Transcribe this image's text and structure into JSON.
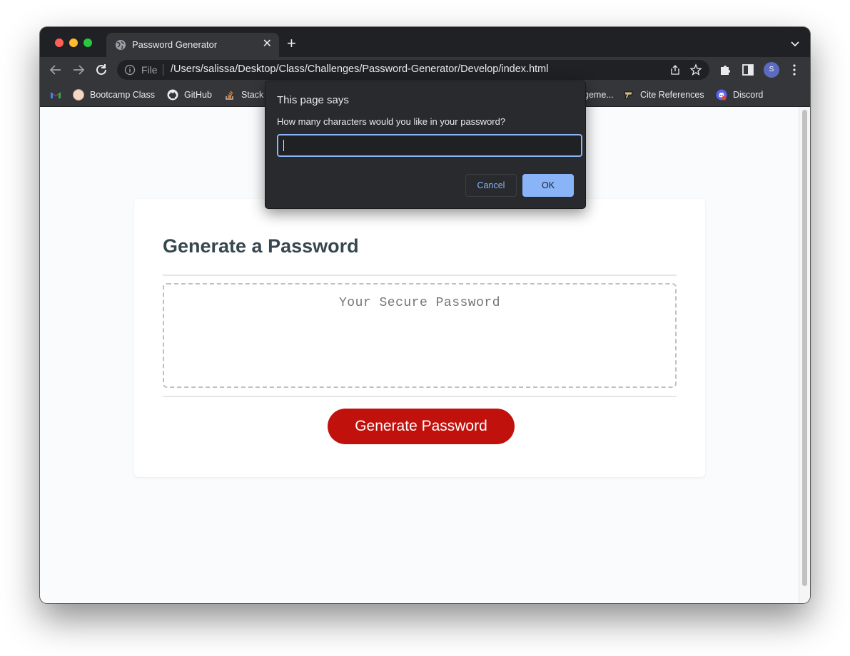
{
  "browser": {
    "tab": {
      "title": "Password Generator",
      "close": "✕"
    },
    "new_tab": "+",
    "omnibox": {
      "scheme_label": "File",
      "url": "/Users/salissa/Desktop/Class/Challenges/Password-Generator/Develop/index.html"
    },
    "profile_initial": "S",
    "bookmarks": [
      {
        "label": "",
        "icon": "gmail-icon"
      },
      {
        "label": "Bootcamp Class",
        "icon": "bootcamp-icon"
      },
      {
        "label": "GitHub",
        "icon": "github-icon"
      },
      {
        "label": "Stack",
        "icon": "stackoverflow-icon"
      },
      {
        "label": "geme...",
        "icon": ""
      },
      {
        "label": "Cite References",
        "icon": "purdue-icon"
      },
      {
        "label": "Discord",
        "icon": "discord-icon"
      }
    ]
  },
  "dialog": {
    "title": "This page says",
    "message": "How many characters would you like in your password?",
    "input_value": "",
    "cancel_label": "Cancel",
    "ok_label": "OK"
  },
  "page": {
    "heading": "Generate a Password",
    "password_placeholder": "Your Secure Password",
    "generate_label": "Generate Password"
  },
  "colors": {
    "generate_button": "#c0110d",
    "heading": "#37474f",
    "dialog_accent": "#8ab4f8"
  }
}
